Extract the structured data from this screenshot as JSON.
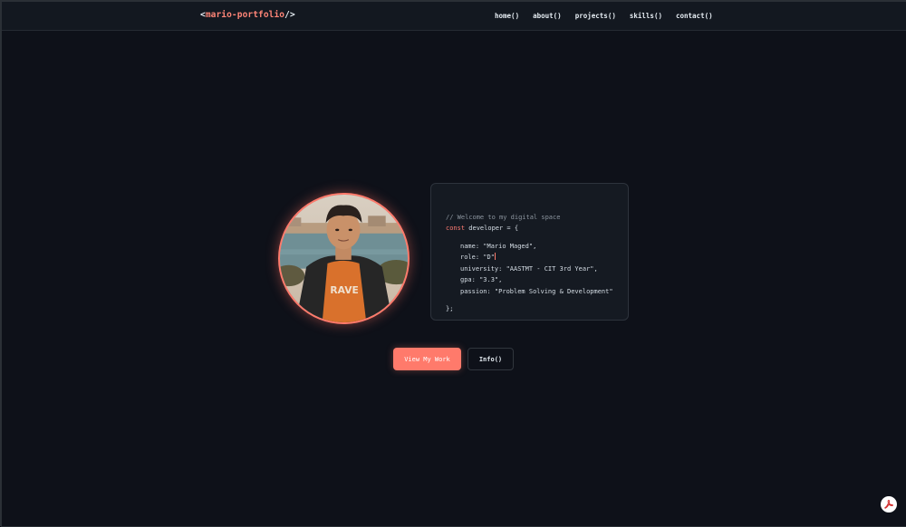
{
  "nav": {
    "logo_prefix": "<",
    "logo_name": "mario-portfolio",
    "logo_suffix": "/>",
    "links": [
      "home()",
      "about()",
      "projects()",
      "skills()",
      "contact()"
    ]
  },
  "profile": {
    "avatar_alt": "Mario Maged"
  },
  "code": {
    "comment": "// Welcome to my digital space",
    "decl_keyword": "const",
    "decl_rest": " developer = {",
    "name_line": "name: \"Mario Maged\",",
    "role_line": "role: \"D\"",
    "university_line": "university: \"AASTMT - CIT 3rd Year\",",
    "gpa_line": "gpa: \"3.3\",",
    "passion_line": "passion: \"Problem Solving & Development\"",
    "close": "};"
  },
  "buttons": {
    "primary": "View My Work",
    "secondary": "Info()"
  },
  "icons": {
    "pdf": "pdf-icon"
  },
  "colors": {
    "accent": "#ff7a6b",
    "background": "#0e1119",
    "card": "#151a22"
  }
}
